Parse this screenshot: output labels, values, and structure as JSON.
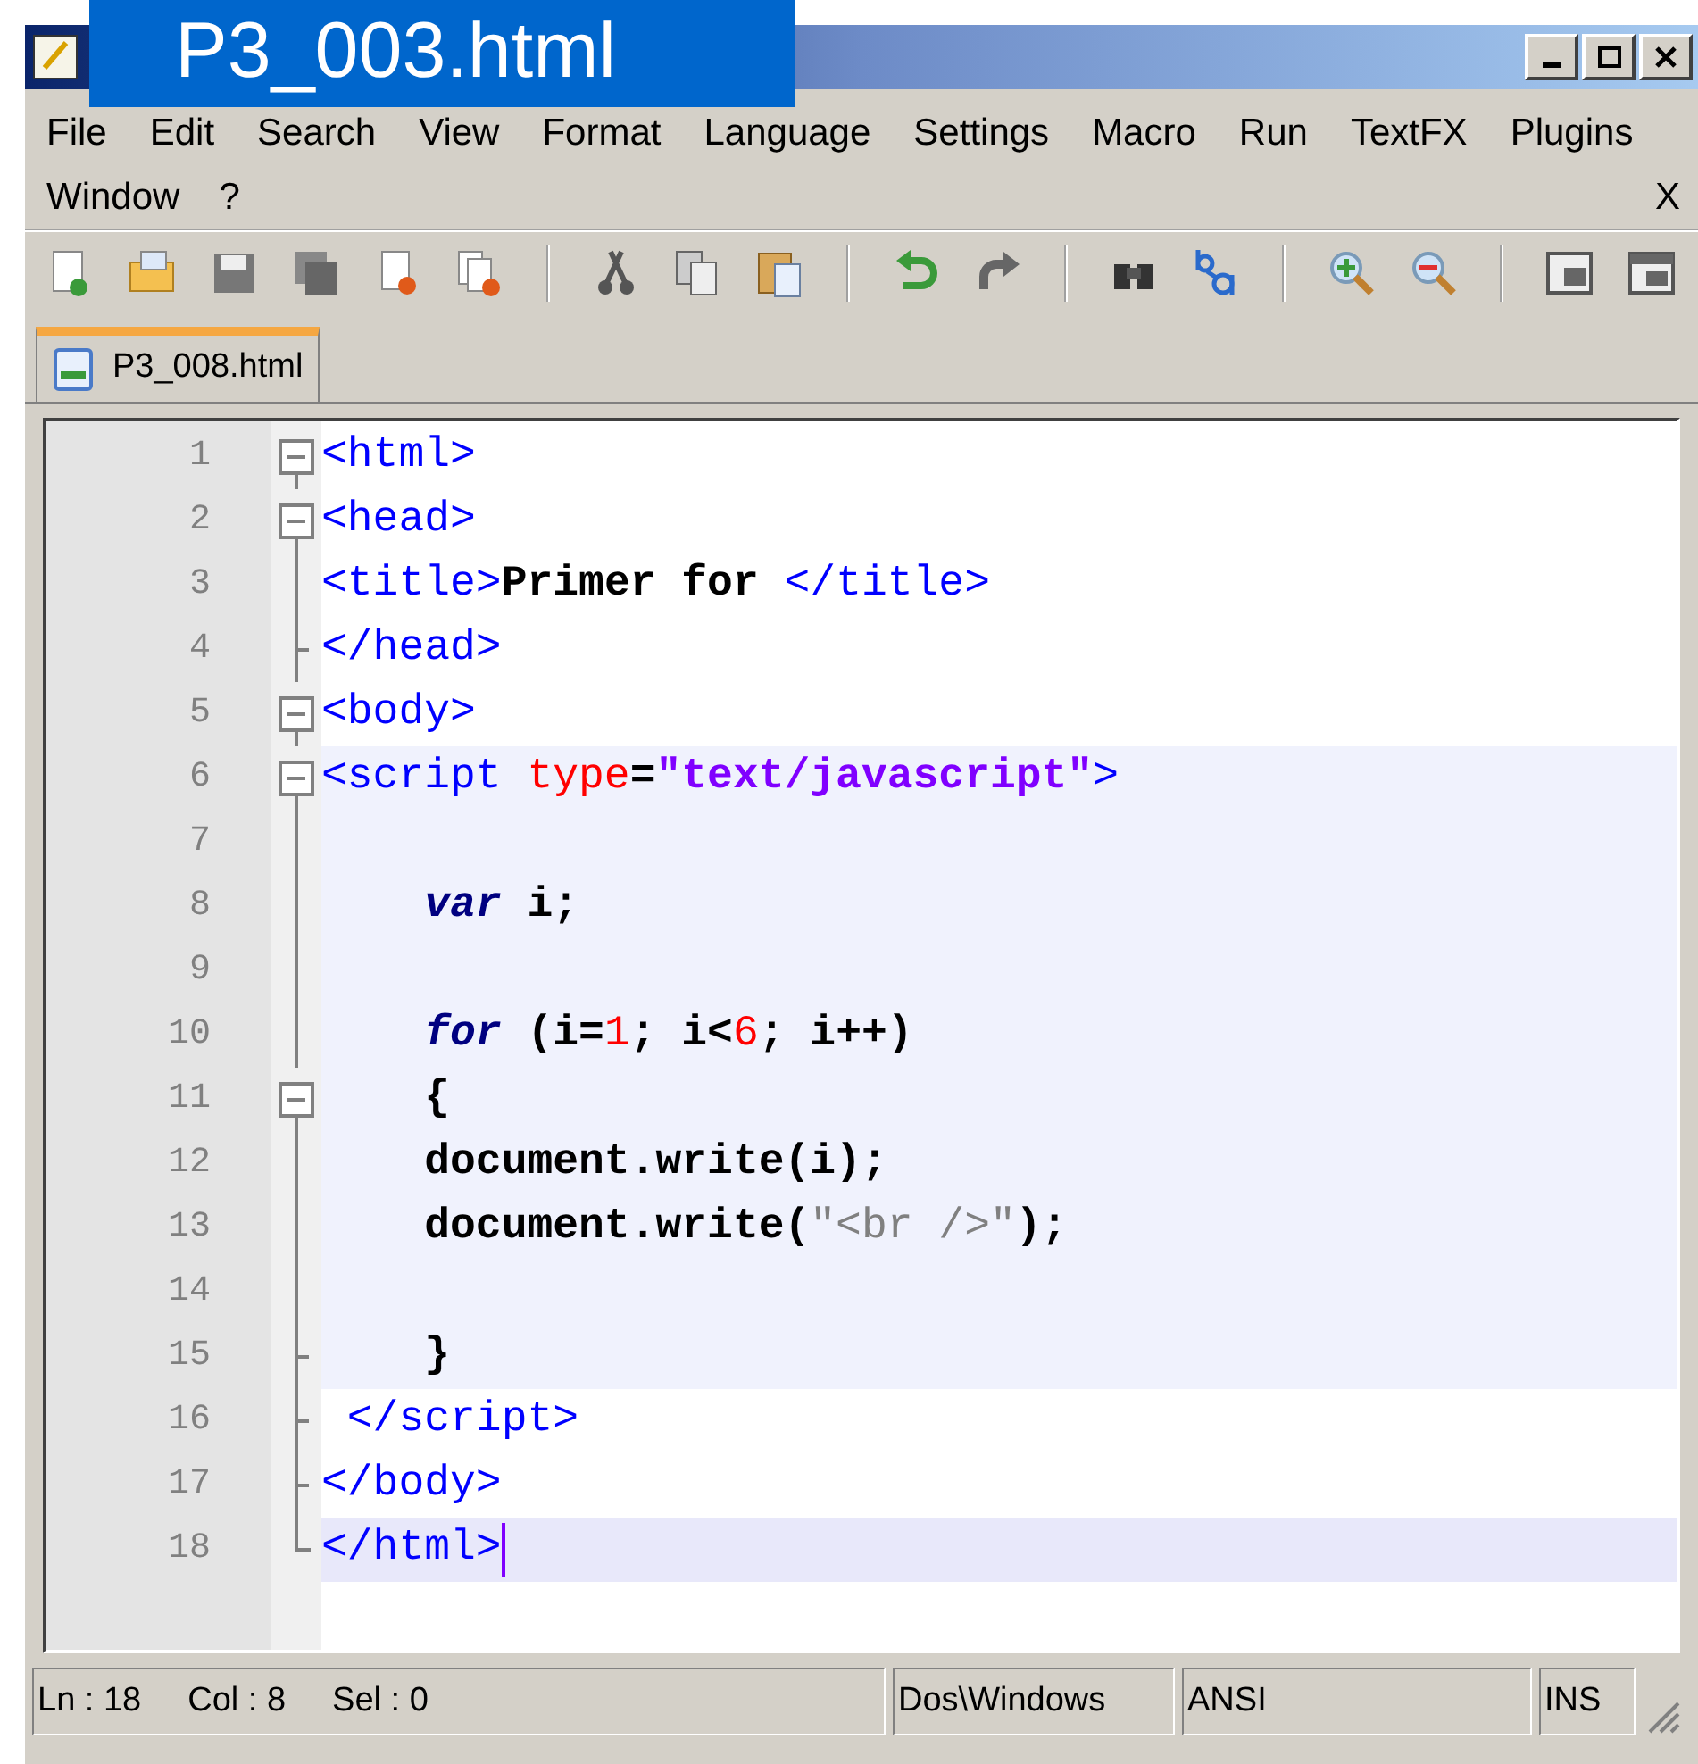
{
  "overlay_label": "P3_003.html",
  "menu": {
    "items": [
      "File",
      "Edit",
      "Search",
      "View",
      "Format",
      "Language",
      "Settings",
      "Macro",
      "Run",
      "TextFX",
      "Plugins",
      "Window",
      "?"
    ],
    "close": "X"
  },
  "tabs": [
    {
      "label": "P3_008.html",
      "selected": true
    }
  ],
  "editor": {
    "lines": [
      {
        "number": "1",
        "foldable": true,
        "block_end": false,
        "in_script": false,
        "current": false,
        "tokens": [
          {
            "kind": "tag",
            "text": "<html>"
          }
        ]
      },
      {
        "number": "2",
        "foldable": true,
        "block_end": false,
        "in_script": false,
        "current": false,
        "tokens": [
          {
            "kind": "tag",
            "text": "<head>"
          }
        ]
      },
      {
        "number": "3",
        "foldable": false,
        "block_end": false,
        "in_script": false,
        "current": false,
        "tokens": [
          {
            "kind": "tag",
            "text": "<title>"
          },
          {
            "kind": "bold",
            "text": "Primer for "
          },
          {
            "kind": "tag",
            "text": "</title>"
          }
        ]
      },
      {
        "number": "4",
        "foldable": false,
        "block_end": true,
        "in_script": false,
        "current": false,
        "tokens": [
          {
            "kind": "tag",
            "text": "</head>"
          }
        ]
      },
      {
        "number": "5",
        "foldable": true,
        "block_end": false,
        "in_script": false,
        "current": false,
        "tokens": [
          {
            "kind": "tag",
            "text": "<body>"
          }
        ]
      },
      {
        "number": "6",
        "foldable": true,
        "block_end": false,
        "in_script": true,
        "current": false,
        "tokens": [
          {
            "kind": "tag",
            "text": "<script "
          },
          {
            "kind": "attr",
            "text": "type"
          },
          {
            "kind": "plain",
            "text": "="
          },
          {
            "kind": "attrval",
            "text": "\"text/javascript\""
          },
          {
            "kind": "tag",
            "text": ">"
          }
        ]
      },
      {
        "number": "7",
        "foldable": false,
        "block_end": false,
        "in_script": true,
        "current": false
      },
      {
        "number": "8",
        "foldable": false,
        "block_end": false,
        "in_script": true,
        "current": false,
        "tokens": [
          {
            "kind": "keyword",
            "text": "    var"
          },
          {
            "kind": "plain",
            "text": " i;"
          }
        ]
      },
      {
        "number": "9",
        "foldable": false,
        "block_end": false,
        "in_script": true,
        "current": false
      },
      {
        "number": "10",
        "foldable": false,
        "block_end": false,
        "in_script": true,
        "current": false,
        "tokens": [
          {
            "kind": "keyword",
            "text": "    for"
          },
          {
            "kind": "plain",
            "text": " (i="
          },
          {
            "kind": "number",
            "text": "1"
          },
          {
            "kind": "plain",
            "text": "; i<"
          },
          {
            "kind": "number",
            "text": "6"
          },
          {
            "kind": "plain",
            "text": "; i++)"
          }
        ]
      },
      {
        "number": "11",
        "foldable": true,
        "block_end": false,
        "in_script": true,
        "current": false,
        "tokens": [
          {
            "kind": "plain",
            "text": "    {"
          }
        ]
      },
      {
        "number": "12",
        "foldable": false,
        "block_end": false,
        "in_script": true,
        "current": false,
        "tokens": [
          {
            "kind": "plain",
            "text": "    document.write(i);"
          }
        ]
      },
      {
        "number": "13",
        "foldable": false,
        "block_end": false,
        "in_script": true,
        "current": false,
        "tokens": [
          {
            "kind": "plain",
            "text": "    document.write("
          },
          {
            "kind": "string",
            "text": "\"<br />\""
          },
          {
            "kind": "plain",
            "text": ");"
          }
        ]
      },
      {
        "number": "14",
        "foldable": false,
        "block_end": false,
        "in_script": true,
        "current": false
      },
      {
        "number": "15",
        "foldable": false,
        "block_end": true,
        "in_script": true,
        "current": false,
        "tokens": [
          {
            "kind": "plain",
            "text": "    }"
          }
        ]
      },
      {
        "number": "16",
        "foldable": false,
        "block_end": true,
        "in_script": false,
        "current": false,
        "tokens": [
          {
            "kind": "tag",
            "text": " </script>"
          }
        ]
      },
      {
        "number": "17",
        "foldable": false,
        "block_end": true,
        "in_script": false,
        "current": false,
        "tokens": [
          {
            "kind": "tag",
            "text": "</body>"
          }
        ]
      },
      {
        "number": "18",
        "foldable": false,
        "block_end": true,
        "in_script": false,
        "current": true,
        "tokens": [
          {
            "kind": "tag",
            "text": "</html>"
          }
        ]
      }
    ]
  },
  "status_bar": [
    {
      "parts": [
        "Ln : 18",
        "Col : 8",
        "Sel : 0"
      ]
    },
    {
      "parts": [
        "Dos\\Windows"
      ]
    },
    {
      "parts": [
        "ANSI"
      ]
    },
    {
      "parts": [
        "INS"
      ]
    }
  ]
}
